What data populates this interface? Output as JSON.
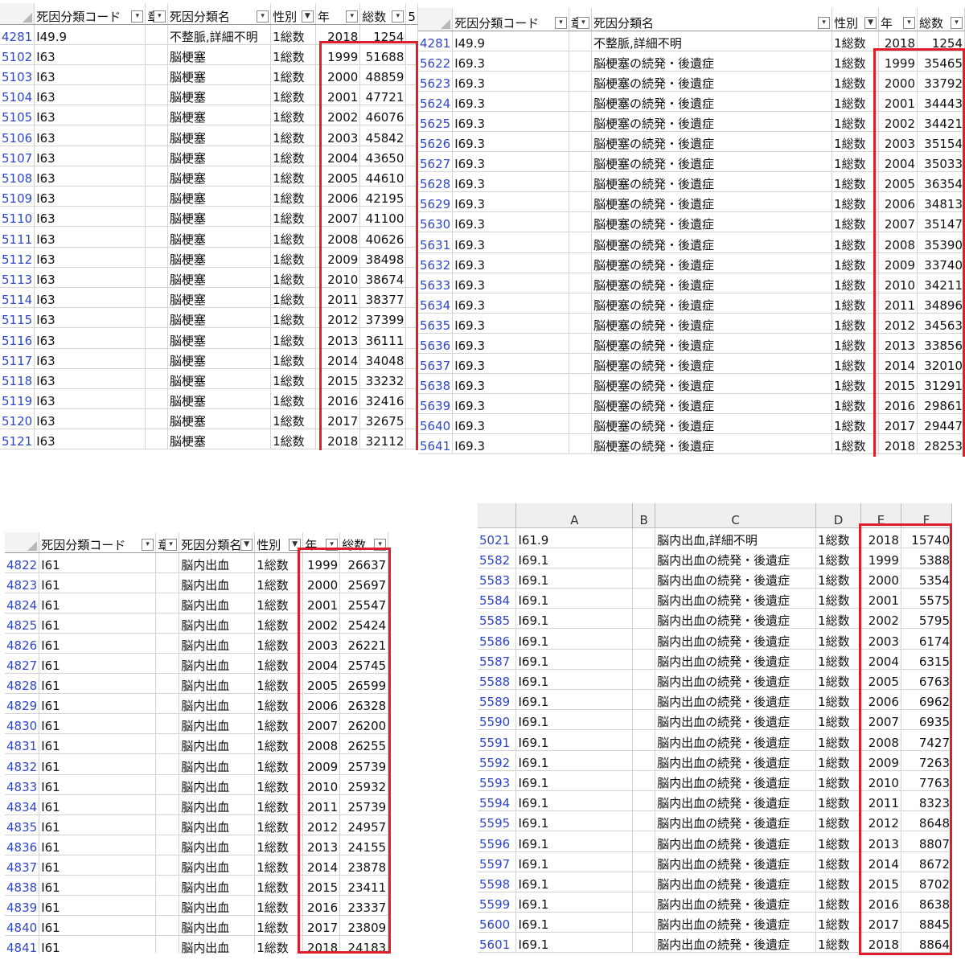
{
  "panel1": {
    "headers": [
      "死因分類コード",
      "章",
      "死因分類名",
      "性別",
      "年",
      "総数",
      "5"
    ],
    "rows": [
      {
        "n": "4281",
        "code": "I49.9",
        "name": "不整脈,詳細不明",
        "sex": "1総数",
        "year": "2018",
        "total": "1254"
      },
      {
        "n": "5102",
        "code": "I63",
        "name": "脳梗塞",
        "sex": "1総数",
        "year": "1999",
        "total": "51688"
      },
      {
        "n": "5103",
        "code": "I63",
        "name": "脳梗塞",
        "sex": "1総数",
        "year": "2000",
        "total": "48859"
      },
      {
        "n": "5104",
        "code": "I63",
        "name": "脳梗塞",
        "sex": "1総数",
        "year": "2001",
        "total": "47721"
      },
      {
        "n": "5105",
        "code": "I63",
        "name": "脳梗塞",
        "sex": "1総数",
        "year": "2002",
        "total": "46076"
      },
      {
        "n": "5106",
        "code": "I63",
        "name": "脳梗塞",
        "sex": "1総数",
        "year": "2003",
        "total": "45842"
      },
      {
        "n": "5107",
        "code": "I63",
        "name": "脳梗塞",
        "sex": "1総数",
        "year": "2004",
        "total": "43650"
      },
      {
        "n": "5108",
        "code": "I63",
        "name": "脳梗塞",
        "sex": "1総数",
        "year": "2005",
        "total": "44610"
      },
      {
        "n": "5109",
        "code": "I63",
        "name": "脳梗塞",
        "sex": "1総数",
        "year": "2006",
        "total": "42195"
      },
      {
        "n": "5110",
        "code": "I63",
        "name": "脳梗塞",
        "sex": "1総数",
        "year": "2007",
        "total": "41100"
      },
      {
        "n": "5111",
        "code": "I63",
        "name": "脳梗塞",
        "sex": "1総数",
        "year": "2008",
        "total": "40626"
      },
      {
        "n": "5112",
        "code": "I63",
        "name": "脳梗塞",
        "sex": "1総数",
        "year": "2009",
        "total": "38498"
      },
      {
        "n": "5113",
        "code": "I63",
        "name": "脳梗塞",
        "sex": "1総数",
        "year": "2010",
        "total": "38674"
      },
      {
        "n": "5114",
        "code": "I63",
        "name": "脳梗塞",
        "sex": "1総数",
        "year": "2011",
        "total": "38377"
      },
      {
        "n": "5115",
        "code": "I63",
        "name": "脳梗塞",
        "sex": "1総数",
        "year": "2012",
        "total": "37399"
      },
      {
        "n": "5116",
        "code": "I63",
        "name": "脳梗塞",
        "sex": "1総数",
        "year": "2013",
        "total": "36111"
      },
      {
        "n": "5117",
        "code": "I63",
        "name": "脳梗塞",
        "sex": "1総数",
        "year": "2014",
        "total": "34048"
      },
      {
        "n": "5118",
        "code": "I63",
        "name": "脳梗塞",
        "sex": "1総数",
        "year": "2015",
        "total": "33232"
      },
      {
        "n": "5119",
        "code": "I63",
        "name": "脳梗塞",
        "sex": "1総数",
        "year": "2016",
        "total": "32416"
      },
      {
        "n": "5120",
        "code": "I63",
        "name": "脳梗塞",
        "sex": "1総数",
        "year": "2017",
        "total": "32675"
      },
      {
        "n": "5121",
        "code": "I63",
        "name": "脳梗塞",
        "sex": "1総数",
        "year": "2018",
        "total": "32112"
      }
    ]
  },
  "panel2": {
    "headers": [
      "死因分類コード",
      "章",
      "死因分類名",
      "性別",
      "年",
      "総数"
    ],
    "rows": [
      {
        "n": "4281",
        "code": "I49.9",
        "name": "不整脈,詳細不明",
        "sex": "1総数",
        "year": "2018",
        "total": "1254"
      },
      {
        "n": "5622",
        "code": "I69.3",
        "name": "脳梗塞の続発・後遺症",
        "sex": "1総数",
        "year": "1999",
        "total": "35465"
      },
      {
        "n": "5623",
        "code": "I69.3",
        "name": "脳梗塞の続発・後遺症",
        "sex": "1総数",
        "year": "2000",
        "total": "33792"
      },
      {
        "n": "5624",
        "code": "I69.3",
        "name": "脳梗塞の続発・後遺症",
        "sex": "1総数",
        "year": "2001",
        "total": "34443"
      },
      {
        "n": "5625",
        "code": "I69.3",
        "name": "脳梗塞の続発・後遺症",
        "sex": "1総数",
        "year": "2002",
        "total": "34421"
      },
      {
        "n": "5626",
        "code": "I69.3",
        "name": "脳梗塞の続発・後遺症",
        "sex": "1総数",
        "year": "2003",
        "total": "35154"
      },
      {
        "n": "5627",
        "code": "I69.3",
        "name": "脳梗塞の続発・後遺症",
        "sex": "1総数",
        "year": "2004",
        "total": "35033"
      },
      {
        "n": "5628",
        "code": "I69.3",
        "name": "脳梗塞の続発・後遺症",
        "sex": "1総数",
        "year": "2005",
        "total": "36354"
      },
      {
        "n": "5629",
        "code": "I69.3",
        "name": "脳梗塞の続発・後遺症",
        "sex": "1総数",
        "year": "2006",
        "total": "34813"
      },
      {
        "n": "5630",
        "code": "I69.3",
        "name": "脳梗塞の続発・後遺症",
        "sex": "1総数",
        "year": "2007",
        "total": "35147"
      },
      {
        "n": "5631",
        "code": "I69.3",
        "name": "脳梗塞の続発・後遺症",
        "sex": "1総数",
        "year": "2008",
        "total": "35390"
      },
      {
        "n": "5632",
        "code": "I69.3",
        "name": "脳梗塞の続発・後遺症",
        "sex": "1総数",
        "year": "2009",
        "total": "33740"
      },
      {
        "n": "5633",
        "code": "I69.3",
        "name": "脳梗塞の続発・後遺症",
        "sex": "1総数",
        "year": "2010",
        "total": "34211"
      },
      {
        "n": "5634",
        "code": "I69.3",
        "name": "脳梗塞の続発・後遺症",
        "sex": "1総数",
        "year": "2011",
        "total": "34896"
      },
      {
        "n": "5635",
        "code": "I69.3",
        "name": "脳梗塞の続発・後遺症",
        "sex": "1総数",
        "year": "2012",
        "total": "34563"
      },
      {
        "n": "5636",
        "code": "I69.3",
        "name": "脳梗塞の続発・後遺症",
        "sex": "1総数",
        "year": "2013",
        "total": "33856"
      },
      {
        "n": "5637",
        "code": "I69.3",
        "name": "脳梗塞の続発・後遺症",
        "sex": "1総数",
        "year": "2014",
        "total": "32010"
      },
      {
        "n": "5638",
        "code": "I69.3",
        "name": "脳梗塞の続発・後遺症",
        "sex": "1総数",
        "year": "2015",
        "total": "31291"
      },
      {
        "n": "5639",
        "code": "I69.3",
        "name": "脳梗塞の続発・後遺症",
        "sex": "1総数",
        "year": "2016",
        "total": "29861"
      },
      {
        "n": "5640",
        "code": "I69.3",
        "name": "脳梗塞の続発・後遺症",
        "sex": "1総数",
        "year": "2017",
        "total": "29447"
      },
      {
        "n": "5641",
        "code": "I69.3",
        "name": "脳梗塞の続発・後遺症",
        "sex": "1総数",
        "year": "2018",
        "total": "28253"
      }
    ]
  },
  "panel3": {
    "headers": [
      "死因分類コード",
      "章",
      "死因分類名",
      "性別",
      "年",
      "総数"
    ],
    "rows": [
      {
        "n": "4822",
        "code": "I61",
        "name": "脳内出血",
        "sex": "1総数",
        "year": "1999",
        "total": "26637"
      },
      {
        "n": "4823",
        "code": "I61",
        "name": "脳内出血",
        "sex": "1総数",
        "year": "2000",
        "total": "25697"
      },
      {
        "n": "4824",
        "code": "I61",
        "name": "脳内出血",
        "sex": "1総数",
        "year": "2001",
        "total": "25547"
      },
      {
        "n": "4825",
        "code": "I61",
        "name": "脳内出血",
        "sex": "1総数",
        "year": "2002",
        "total": "25424"
      },
      {
        "n": "4826",
        "code": "I61",
        "name": "脳内出血",
        "sex": "1総数",
        "year": "2003",
        "total": "26221"
      },
      {
        "n": "4827",
        "code": "I61",
        "name": "脳内出血",
        "sex": "1総数",
        "year": "2004",
        "total": "25745"
      },
      {
        "n": "4828",
        "code": "I61",
        "name": "脳内出血",
        "sex": "1総数",
        "year": "2005",
        "total": "26599"
      },
      {
        "n": "4829",
        "code": "I61",
        "name": "脳内出血",
        "sex": "1総数",
        "year": "2006",
        "total": "26328"
      },
      {
        "n": "4830",
        "code": "I61",
        "name": "脳内出血",
        "sex": "1総数",
        "year": "2007",
        "total": "26200"
      },
      {
        "n": "4831",
        "code": "I61",
        "name": "脳内出血",
        "sex": "1総数",
        "year": "2008",
        "total": "26255"
      },
      {
        "n": "4832",
        "code": "I61",
        "name": "脳内出血",
        "sex": "1総数",
        "year": "2009",
        "total": "25739"
      },
      {
        "n": "4833",
        "code": "I61",
        "name": "脳内出血",
        "sex": "1総数",
        "year": "2010",
        "total": "25932"
      },
      {
        "n": "4834",
        "code": "I61",
        "name": "脳内出血",
        "sex": "1総数",
        "year": "2011",
        "total": "25739"
      },
      {
        "n": "4835",
        "code": "I61",
        "name": "脳内出血",
        "sex": "1総数",
        "year": "2012",
        "total": "24957"
      },
      {
        "n": "4836",
        "code": "I61",
        "name": "脳内出血",
        "sex": "1総数",
        "year": "2013",
        "total": "24155"
      },
      {
        "n": "4837",
        "code": "I61",
        "name": "脳内出血",
        "sex": "1総数",
        "year": "2014",
        "total": "23878"
      },
      {
        "n": "4838",
        "code": "I61",
        "name": "脳内出血",
        "sex": "1総数",
        "year": "2015",
        "total": "23411"
      },
      {
        "n": "4839",
        "code": "I61",
        "name": "脳内出血",
        "sex": "1総数",
        "year": "2016",
        "total": "23337"
      },
      {
        "n": "4840",
        "code": "I61",
        "name": "脳内出血",
        "sex": "1総数",
        "year": "2017",
        "total": "23809"
      },
      {
        "n": "4841",
        "code": "I61",
        "name": "脳内出血",
        "sex": "1総数",
        "year": "2018",
        "total": "24183"
      }
    ]
  },
  "panel4": {
    "headers": [
      "A",
      "B",
      "C",
      "D",
      "E",
      "F"
    ],
    "rows": [
      {
        "n": "5021",
        "code": "I61.9",
        "name": "脳内出血,詳細不明",
        "sex": "1総数",
        "year": "2018",
        "total": "15740"
      },
      {
        "n": "5582",
        "code": "I69.1",
        "name": "脳内出血の続発・後遺症",
        "sex": "1総数",
        "year": "1999",
        "total": "5388"
      },
      {
        "n": "5583",
        "code": "I69.1",
        "name": "脳内出血の続発・後遺症",
        "sex": "1総数",
        "year": "2000",
        "total": "5354"
      },
      {
        "n": "5584",
        "code": "I69.1",
        "name": "脳内出血の続発・後遺症",
        "sex": "1総数",
        "year": "2001",
        "total": "5575"
      },
      {
        "n": "5585",
        "code": "I69.1",
        "name": "脳内出血の続発・後遺症",
        "sex": "1総数",
        "year": "2002",
        "total": "5795"
      },
      {
        "n": "5586",
        "code": "I69.1",
        "name": "脳内出血の続発・後遺症",
        "sex": "1総数",
        "year": "2003",
        "total": "6174"
      },
      {
        "n": "5587",
        "code": "I69.1",
        "name": "脳内出血の続発・後遺症",
        "sex": "1総数",
        "year": "2004",
        "total": "6315"
      },
      {
        "n": "5588",
        "code": "I69.1",
        "name": "脳内出血の続発・後遺症",
        "sex": "1総数",
        "year": "2005",
        "total": "6763"
      },
      {
        "n": "5589",
        "code": "I69.1",
        "name": "脳内出血の続発・後遺症",
        "sex": "1総数",
        "year": "2006",
        "total": "6962"
      },
      {
        "n": "5590",
        "code": "I69.1",
        "name": "脳内出血の続発・後遺症",
        "sex": "1総数",
        "year": "2007",
        "total": "6935"
      },
      {
        "n": "5591",
        "code": "I69.1",
        "name": "脳内出血の続発・後遺症",
        "sex": "1総数",
        "year": "2008",
        "total": "7427"
      },
      {
        "n": "5592",
        "code": "I69.1",
        "name": "脳内出血の続発・後遺症",
        "sex": "1総数",
        "year": "2009",
        "total": "7263"
      },
      {
        "n": "5593",
        "code": "I69.1",
        "name": "脳内出血の続発・後遺症",
        "sex": "1総数",
        "year": "2010",
        "total": "7763"
      },
      {
        "n": "5594",
        "code": "I69.1",
        "name": "脳内出血の続発・後遺症",
        "sex": "1総数",
        "year": "2011",
        "total": "8323"
      },
      {
        "n": "5595",
        "code": "I69.1",
        "name": "脳内出血の続発・後遺症",
        "sex": "1総数",
        "year": "2012",
        "total": "8648"
      },
      {
        "n": "5596",
        "code": "I69.1",
        "name": "脳内出血の続発・後遺症",
        "sex": "1総数",
        "year": "2013",
        "total": "8807"
      },
      {
        "n": "5597",
        "code": "I69.1",
        "name": "脳内出血の続発・後遺症",
        "sex": "1総数",
        "year": "2014",
        "total": "8672"
      },
      {
        "n": "5598",
        "code": "I69.1",
        "name": "脳内出血の続発・後遺症",
        "sex": "1総数",
        "year": "2015",
        "total": "8702"
      },
      {
        "n": "5599",
        "code": "I69.1",
        "name": "脳内出血の続発・後遺症",
        "sex": "1総数",
        "year": "2016",
        "total": "8638"
      },
      {
        "n": "5600",
        "code": "I69.1",
        "name": "脳内出血の続発・後遺症",
        "sex": "1総数",
        "year": "2017",
        "total": "8845"
      },
      {
        "n": "5601",
        "code": "I69.1",
        "name": "脳内出血の続発・後遺症",
        "sex": "1総数",
        "year": "2018",
        "total": "8864"
      }
    ]
  },
  "colors": {
    "highlight_box": "#e01d2a",
    "row_number": "#2f46c6",
    "gridline": "#d4d4d4"
  }
}
